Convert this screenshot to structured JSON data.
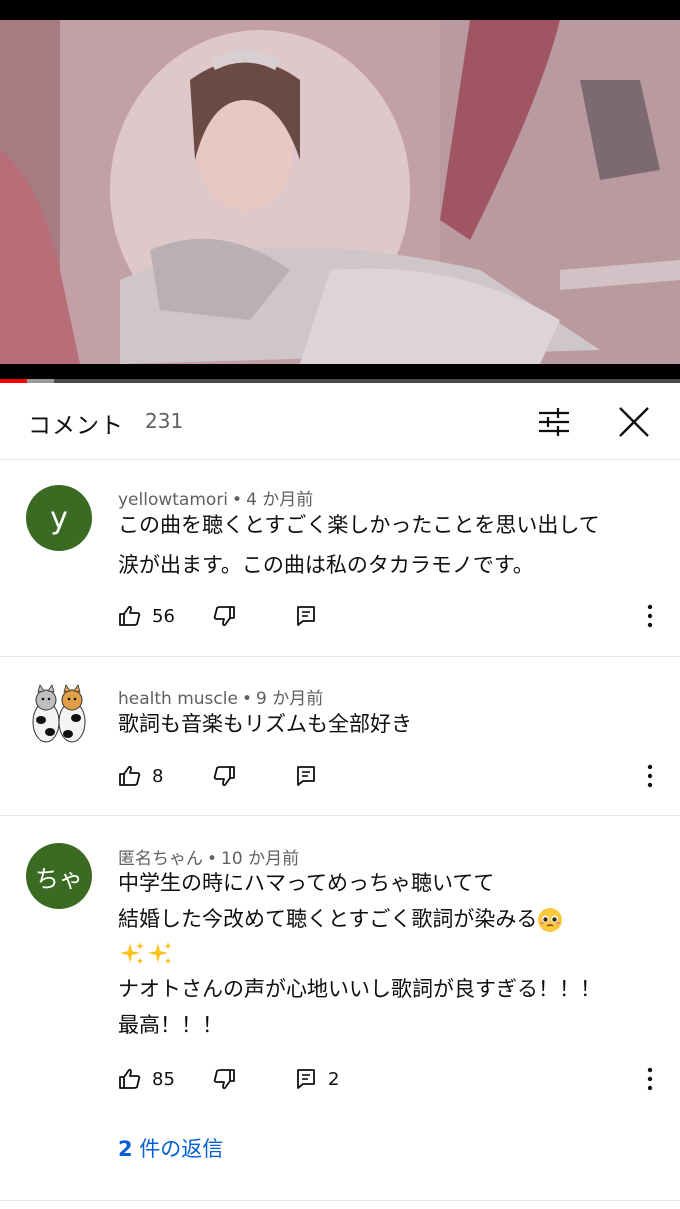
{
  "comments_panel": {
    "title": "コメント",
    "count": "231"
  },
  "video": {
    "progress_fraction": 0.04,
    "buffer_fraction": 0.08
  },
  "colors": {
    "avatar_green": "#3b6b22",
    "link_blue": "#065fd4",
    "progress_red": "#ff0000"
  },
  "comments": [
    {
      "avatar_text": "y",
      "author": "yellowtamori",
      "time": "4 か月前",
      "lines": [
        "この曲を聴くとすごく楽しかったことを思い出して",
        "涙が出ます。この曲は私のタカラモノです。"
      ],
      "likes": "56",
      "reply_count": ""
    },
    {
      "avatar_text": "",
      "avatar_icon": "cat-pair-avatar",
      "author": "health muscle",
      "time": "9 か月前",
      "lines": [
        "歌詞も音楽もリズムも全部好き"
      ],
      "likes": "8",
      "reply_count": ""
    },
    {
      "avatar_text": "ちゃ",
      "author": "匿名ちゃん",
      "time": "10 か月前",
      "lines": [
        "中学生の時にハマってめっちゃ聴いてて",
        "結婚した今改めて聴くとすごく歌詞が染みる",
        "ナオトさんの声が心地いいし歌詞が良すぎる！！！",
        "最高！！！"
      ],
      "emojis": [
        "pleading-face-emoji",
        "sparkles-emoji",
        "sparkles-emoji"
      ],
      "likes": "85",
      "reply_count": "2",
      "replies_link": {
        "count": "2",
        "label": " 件の返信"
      }
    }
  ]
}
